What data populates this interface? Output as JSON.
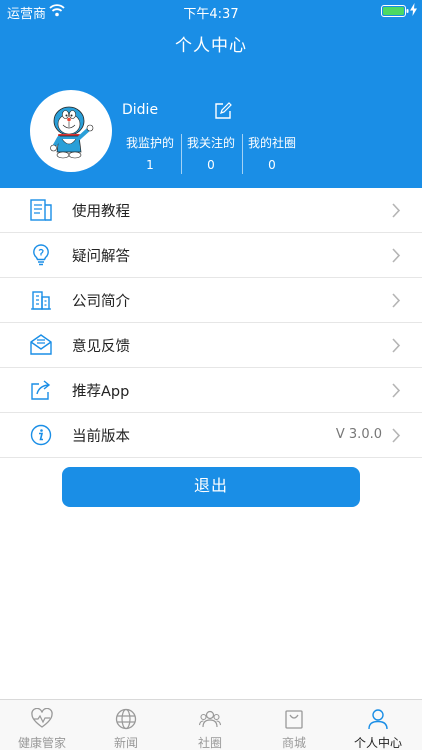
{
  "status_bar": {
    "carrier": "运营商",
    "time": "下午4:37"
  },
  "header": {
    "title": "个人中心"
  },
  "profile": {
    "username": "Didie",
    "stats": [
      {
        "label": "我监护的",
        "value": "1"
      },
      {
        "label": "我关注的",
        "value": "0"
      },
      {
        "label": "我的社圈",
        "value": "0"
      }
    ]
  },
  "menu": [
    {
      "label": "使用教程",
      "icon": "document-icon"
    },
    {
      "label": "疑问解答",
      "icon": "lightbulb-icon"
    },
    {
      "label": "公司简介",
      "icon": "building-icon"
    },
    {
      "label": "意见反馈",
      "icon": "mail-icon"
    },
    {
      "label": "推荐App",
      "icon": "share-icon"
    },
    {
      "label": "当前版本",
      "icon": "info-icon",
      "value": "V 3.0.0"
    }
  ],
  "logout_label": "退出",
  "tabs": [
    {
      "label": "健康管家",
      "icon": "heart-icon"
    },
    {
      "label": "新闻",
      "icon": "globe-icon"
    },
    {
      "label": "社圈",
      "icon": "people-icon"
    },
    {
      "label": "商城",
      "icon": "shopping-bag-icon"
    },
    {
      "label": "个人中心",
      "icon": "person-icon",
      "active": true
    }
  ],
  "colors": {
    "primary": "#1a8ee6",
    "icon_blue": "#1a8ee6",
    "inactive_tab": "#999999"
  }
}
